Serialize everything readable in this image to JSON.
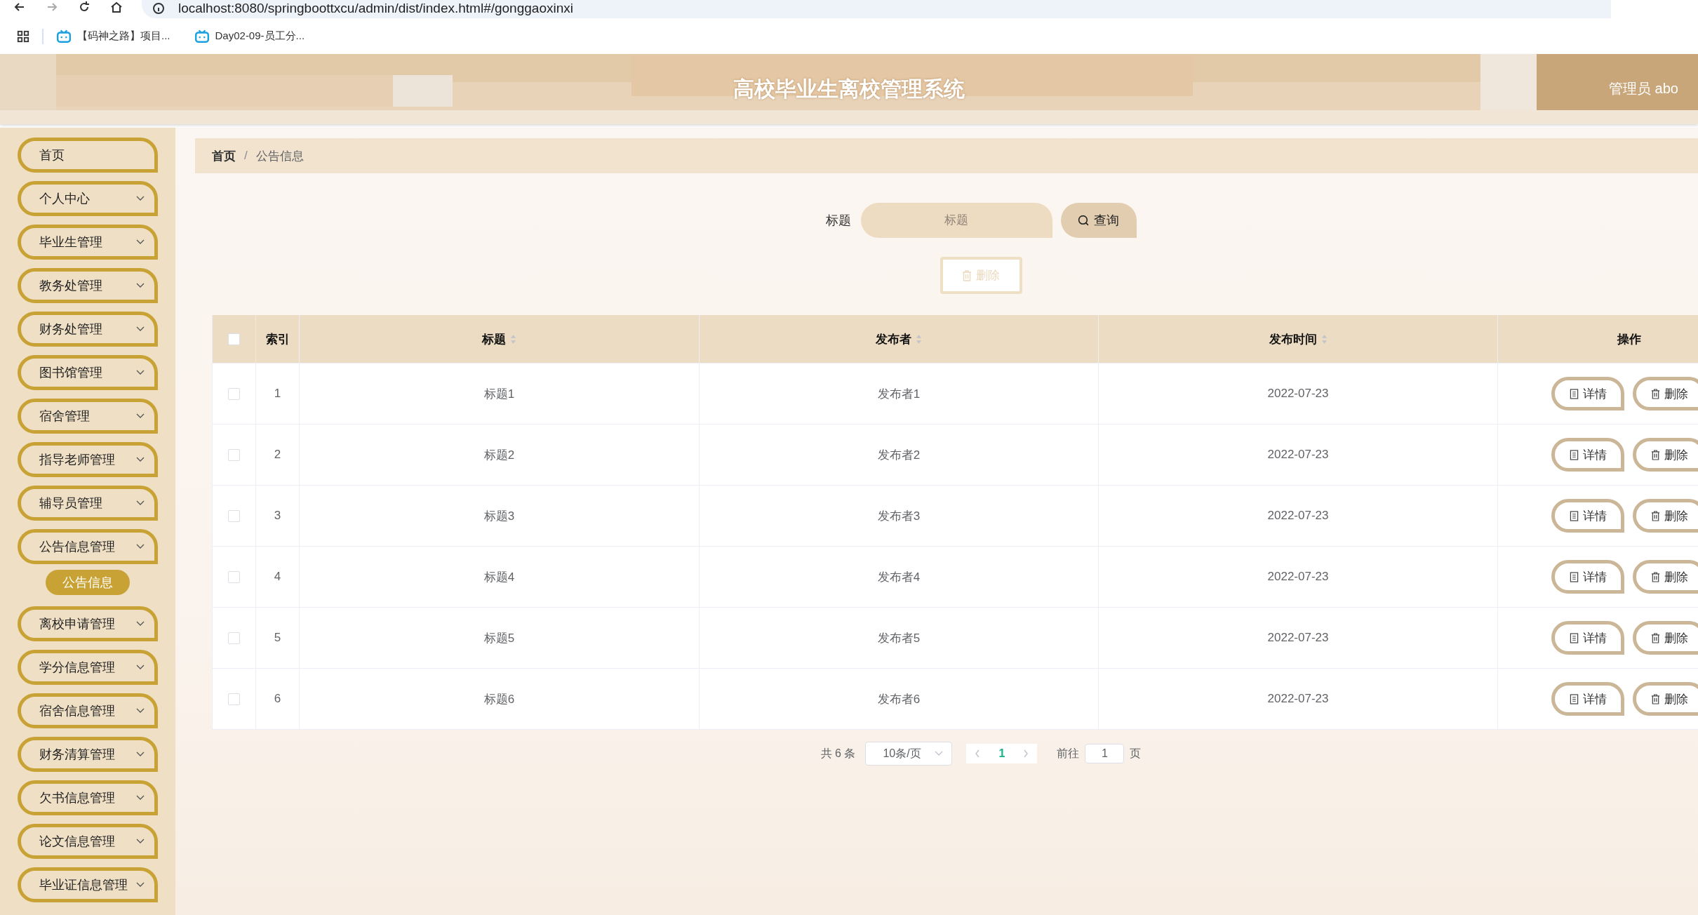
{
  "browser": {
    "url": "localhost:8080/springboottxcu/admin/dist/index.html#/gonggaoxinxi",
    "bookmarks": [
      {
        "label": "【码神之路】项目..."
      },
      {
        "label": "Day02-09-员工分..."
      }
    ]
  },
  "header": {
    "title": "高校毕业生离校管理系统",
    "user": "管理员 abo"
  },
  "sidebar": {
    "items": [
      {
        "kind": "link",
        "label": "首页"
      },
      {
        "kind": "menu",
        "label": "个人中心"
      },
      {
        "kind": "menu",
        "label": "毕业生管理"
      },
      {
        "kind": "menu",
        "label": "教务处管理"
      },
      {
        "kind": "menu",
        "label": "财务处管理"
      },
      {
        "kind": "menu",
        "label": "图书馆管理"
      },
      {
        "kind": "menu",
        "label": "宿舍管理"
      },
      {
        "kind": "menu",
        "label": "指导老师管理"
      },
      {
        "kind": "menu",
        "label": "辅导员管理"
      },
      {
        "kind": "menu",
        "label": "公告信息管理",
        "children": [
          {
            "label": "公告信息",
            "selected": true
          }
        ]
      },
      {
        "kind": "menu",
        "label": "离校申请管理"
      },
      {
        "kind": "menu",
        "label": "学分信息管理"
      },
      {
        "kind": "menu",
        "label": "宿舍信息管理"
      },
      {
        "kind": "menu",
        "label": "财务清算管理"
      },
      {
        "kind": "menu",
        "label": "欠书信息管理"
      },
      {
        "kind": "menu",
        "label": "论文信息管理"
      },
      {
        "kind": "menu",
        "label": "毕业证信息管理"
      }
    ]
  },
  "breadcrumb": {
    "items": [
      "首页",
      "公告信息"
    ],
    "separator": "/"
  },
  "search": {
    "label": "标题",
    "placeholder": "标题",
    "button": "查询"
  },
  "delete_button": {
    "label": "删除",
    "disabled": true
  },
  "table": {
    "all_selected": false,
    "columns": [
      {
        "label": "索引",
        "sortable": false
      },
      {
        "label": "标题",
        "sortable": true
      },
      {
        "label": "发布者",
        "sortable": true
      },
      {
        "label": "发布时间",
        "sortable": true
      },
      {
        "label": "操作",
        "sortable": false
      }
    ],
    "rows": [
      {
        "selected": false,
        "index": "1",
        "title": "标题1",
        "publisher": "发布者1",
        "time": "2022-07-23",
        "actions": [
          "详情",
          "删除"
        ]
      },
      {
        "selected": false,
        "index": "2",
        "title": "标题2",
        "publisher": "发布者2",
        "time": "2022-07-23",
        "actions": [
          "详情",
          "删除"
        ]
      },
      {
        "selected": false,
        "index": "3",
        "title": "标题3",
        "publisher": "发布者3",
        "time": "2022-07-23",
        "actions": [
          "详情",
          "删除"
        ]
      },
      {
        "selected": false,
        "index": "4",
        "title": "标题4",
        "publisher": "发布者4",
        "time": "2022-07-23",
        "actions": [
          "详情",
          "删除"
        ]
      },
      {
        "selected": false,
        "index": "5",
        "title": "标题5",
        "publisher": "发布者5",
        "time": "2022-07-23",
        "actions": [
          "详情",
          "删除"
        ]
      },
      {
        "selected": false,
        "index": "6",
        "title": "标题6",
        "publisher": "发布者6",
        "time": "2022-07-23",
        "actions": [
          "详情",
          "删除"
        ]
      }
    ]
  },
  "pagination": {
    "total": "共 6 条",
    "page_size": "10条/页",
    "pages": [
      {
        "label": "1",
        "selected": true
      }
    ],
    "goto_label": "前往",
    "goto_value": "1",
    "page_suffix": "页"
  }
}
